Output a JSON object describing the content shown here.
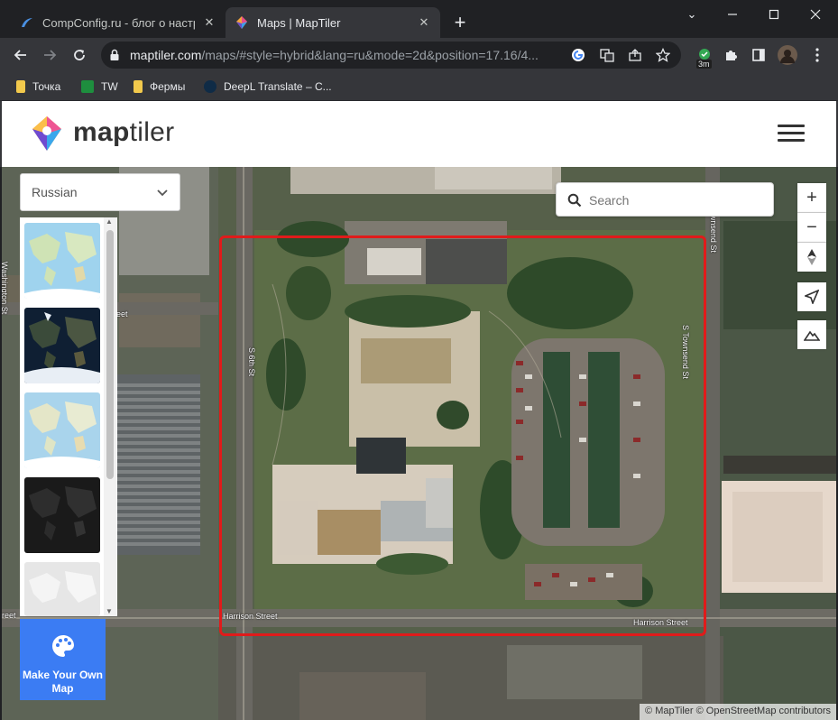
{
  "browser": {
    "tabs": [
      {
        "title": "CompConfig.ru - блог о настрой",
        "icon": "compconfig-favicon",
        "active": false
      },
      {
        "title": "Maps | MapTiler",
        "icon": "maptiler-favicon",
        "active": true
      }
    ],
    "new_tab_label": "+",
    "url_domain": "maptiler.com",
    "url_path": "/maps/#style=hybrid&lang=ru&mode=2d&position=17.16/4...",
    "extension_badge": "3m",
    "bookmarks": [
      {
        "label": "Точка",
        "icon": "folder-icon",
        "color": "#f2c94c"
      },
      {
        "label": "TW",
        "icon": "sheets-icon",
        "color": "#1e8e3e"
      },
      {
        "label": "Фермы",
        "icon": "folder-icon",
        "color": "#f2c94c"
      },
      {
        "label": "DeepL Translate – С...",
        "icon": "deepl-icon",
        "color": "#0f2b46"
      }
    ]
  },
  "site": {
    "brand_bold": "map",
    "brand_light": "tiler",
    "menu_icon": "hamburger-icon"
  },
  "map": {
    "language_select": {
      "value": "Russian"
    },
    "search": {
      "placeholder": "Search"
    },
    "style_thumbnails": [
      "streets",
      "dark-blue",
      "light",
      "dark",
      "grey"
    ],
    "make_your_own_map": "Make Your Own Map",
    "controls": {
      "zoom_in": "+",
      "zoom_out": "−"
    },
    "street_labels": {
      "harrison_left": "Harrison Street",
      "harrison_right": "Harrison Street",
      "sixth": "S 6th St",
      "townsend": "S Townsend St",
      "townsend_lower": "S Townsend St",
      "washington": "Washington St",
      "street_frag_left": "eet",
      "reet_left": "reet"
    },
    "attribution": "© MapTiler © OpenStreetMap contributors",
    "highlight_color": "#e01b1b"
  }
}
